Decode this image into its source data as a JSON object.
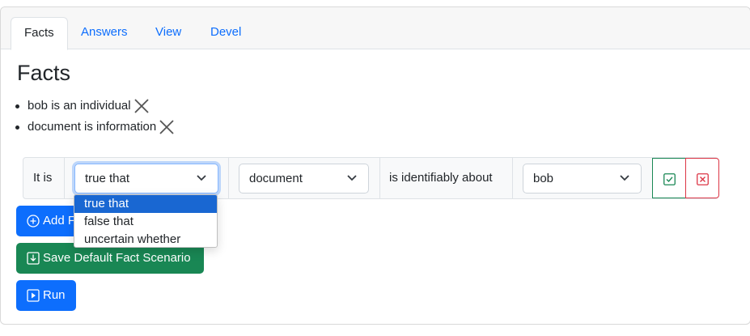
{
  "tabs": [
    {
      "label": "Facts",
      "active": true
    },
    {
      "label": "Answers",
      "active": false
    },
    {
      "label": "View",
      "active": false
    },
    {
      "label": "Devel",
      "active": false
    }
  ],
  "title": "Facts",
  "facts": [
    {
      "text": "bob is an individual",
      "remove_icon": "close-icon"
    },
    {
      "text": "document is information",
      "remove_icon": "close-icon"
    }
  ],
  "builder": {
    "prefix": "It is",
    "truth_select": {
      "value": "true that",
      "options": [
        "true that",
        "false that",
        "uncertain whether"
      ],
      "open": true
    },
    "subject_select": {
      "value": "document"
    },
    "predicate": "is identifiably about",
    "object_select": {
      "value": "bob"
    },
    "confirm_icon": "check-square-icon",
    "cancel_icon": "x-square-icon"
  },
  "buttons": {
    "add_fact": "Add Fact",
    "save_default": "Save Default Fact Scenario",
    "run": "Run"
  },
  "colors": {
    "primary": "#0d6efd",
    "success": "#198754",
    "danger": "#dc3545",
    "dropdown_highlight": "#1967d2"
  }
}
